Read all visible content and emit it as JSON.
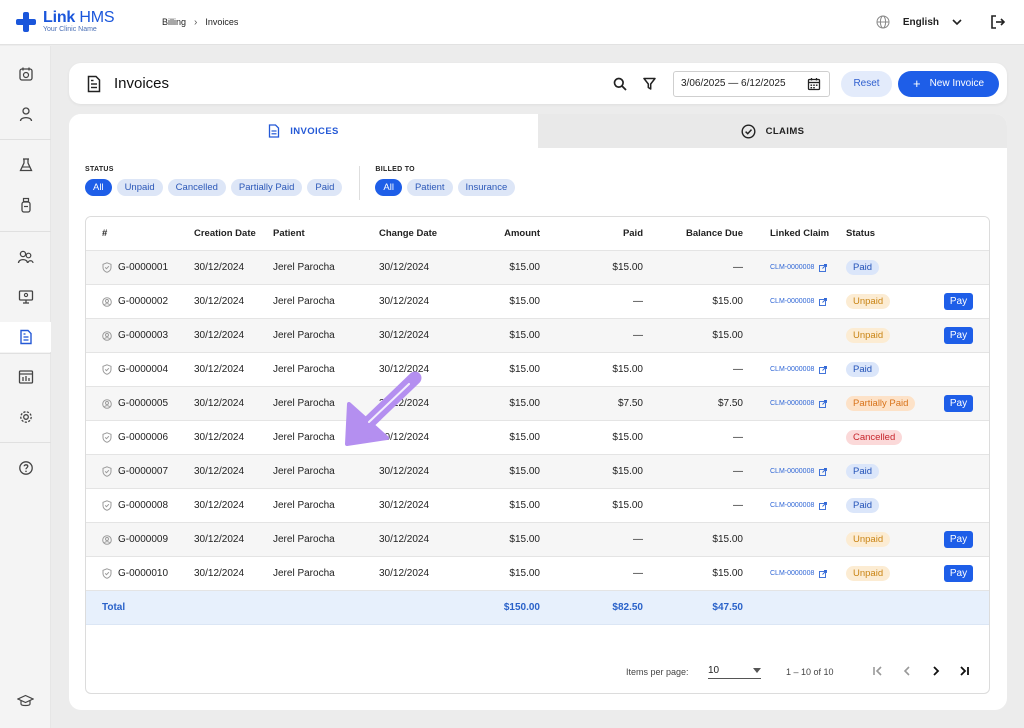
{
  "app": {
    "name_bold": "Link",
    "name_rest": " HMS",
    "subtitle": "Your Clinic Name",
    "brand_color": "#1a56db"
  },
  "breadcrumb": [
    "Billing",
    "Invoices"
  ],
  "language": "English",
  "sidebar_icons": [
    "calendar-icon",
    "patient-icon",
    "lab-flask-icon",
    "medicine-bottle-icon",
    "staff-group-icon",
    "monitor-icon",
    "invoice-icon",
    "report-icon",
    "settings-gear-icon",
    "help-icon",
    "graduation-cap-icon"
  ],
  "header": {
    "title": "Invoices",
    "date_range": "3/06/2025 — 6/12/2025",
    "reset_label": "Reset",
    "new_label": "New Invoice"
  },
  "tabs": [
    {
      "label": "INVOICES",
      "active": true
    },
    {
      "label": "CLAIMS",
      "active": false
    }
  ],
  "filters": {
    "status_label": "STATUS",
    "status_options": [
      "All",
      "Unpaid",
      "Cancelled",
      "Partially Paid",
      "Paid"
    ],
    "status_selected": "All",
    "billed_label": "BILLED TO",
    "billed_options": [
      "All",
      "Patient",
      "Insurance"
    ],
    "billed_selected": "All"
  },
  "table": {
    "columns": [
      "#",
      "Creation Date",
      "Patient",
      "Change Date",
      "Amount",
      "Paid",
      "Balance Due",
      "Linked Claim",
      "Status"
    ],
    "rows": [
      {
        "id": "G-0000001",
        "icon": "shield",
        "created": "30/12/2024",
        "patient": "Jerel Parocha",
        "changed": "30/12/2024",
        "amount": "$15.00",
        "paid": "$15.00",
        "balance": "—",
        "claim": "CLM-0000008",
        "status": "Paid",
        "pay": false
      },
      {
        "id": "G-0000002",
        "icon": "person",
        "created": "30/12/2024",
        "patient": "Jerel Parocha",
        "changed": "30/12/2024",
        "amount": "$15.00",
        "paid": "—",
        "balance": "$15.00",
        "claim": "CLM-0000008",
        "status": "Unpaid",
        "pay": true
      },
      {
        "id": "G-0000003",
        "icon": "person",
        "created": "30/12/2024",
        "patient": "Jerel Parocha",
        "changed": "30/12/2024",
        "amount": "$15.00",
        "paid": "—",
        "balance": "$15.00",
        "claim": "",
        "status": "Unpaid",
        "pay": true
      },
      {
        "id": "G-0000004",
        "icon": "shield",
        "created": "30/12/2024",
        "patient": "Jerel Parocha",
        "changed": "30/12/2024",
        "amount": "$15.00",
        "paid": "$15.00",
        "balance": "—",
        "claim": "CLM-0000008",
        "status": "Paid",
        "pay": false
      },
      {
        "id": "G-0000005",
        "icon": "person",
        "created": "30/12/2024",
        "patient": "Jerel Parocha",
        "changed": "30/12/2024",
        "amount": "$15.00",
        "paid": "$7.50",
        "balance": "$7.50",
        "claim": "CLM-0000008",
        "status": "Partially Paid",
        "pay": true
      },
      {
        "id": "G-0000006",
        "icon": "shield",
        "created": "30/12/2024",
        "patient": "Jerel Parocha",
        "changed": "30/12/2024",
        "amount": "$15.00",
        "paid": "$15.00",
        "balance": "—",
        "claim": "",
        "status": "Cancelled",
        "pay": false
      },
      {
        "id": "G-0000007",
        "icon": "shield",
        "created": "30/12/2024",
        "patient": "Jerel Parocha",
        "changed": "30/12/2024",
        "amount": "$15.00",
        "paid": "$15.00",
        "balance": "—",
        "claim": "CLM-0000008",
        "status": "Paid",
        "pay": false
      },
      {
        "id": "G-0000008",
        "icon": "shield",
        "created": "30/12/2024",
        "patient": "Jerel Parocha",
        "changed": "30/12/2024",
        "amount": "$15.00",
        "paid": "$15.00",
        "balance": "—",
        "claim": "CLM-0000008",
        "status": "Paid",
        "pay": false
      },
      {
        "id": "G-0000009",
        "icon": "person",
        "created": "30/12/2024",
        "patient": "Jerel Parocha",
        "changed": "30/12/2024",
        "amount": "$15.00",
        "paid": "—",
        "balance": "$15.00",
        "claim": "",
        "status": "Unpaid",
        "pay": true
      },
      {
        "id": "G-0000010",
        "icon": "shield",
        "created": "30/12/2024",
        "patient": "Jerel Parocha",
        "changed": "30/12/2024",
        "amount": "$15.00",
        "paid": "—",
        "balance": "$15.00",
        "claim": "CLM-0000008",
        "status": "Unpaid",
        "pay": true
      }
    ],
    "pay_label": "Pay",
    "total": {
      "label": "Total",
      "amount": "$150.00",
      "paid": "$82.50",
      "balance": "$47.50"
    }
  },
  "pagination": {
    "items_label": "Items per page:",
    "per_page": "10",
    "range": "1 – 10 of 10"
  },
  "status_colors": {
    "paid": "#2453b8",
    "unpaid": "#c98414",
    "partial": "#d8731a",
    "cancelled": "#c7252b"
  },
  "annotation_arrow_color": "#b48ff0"
}
